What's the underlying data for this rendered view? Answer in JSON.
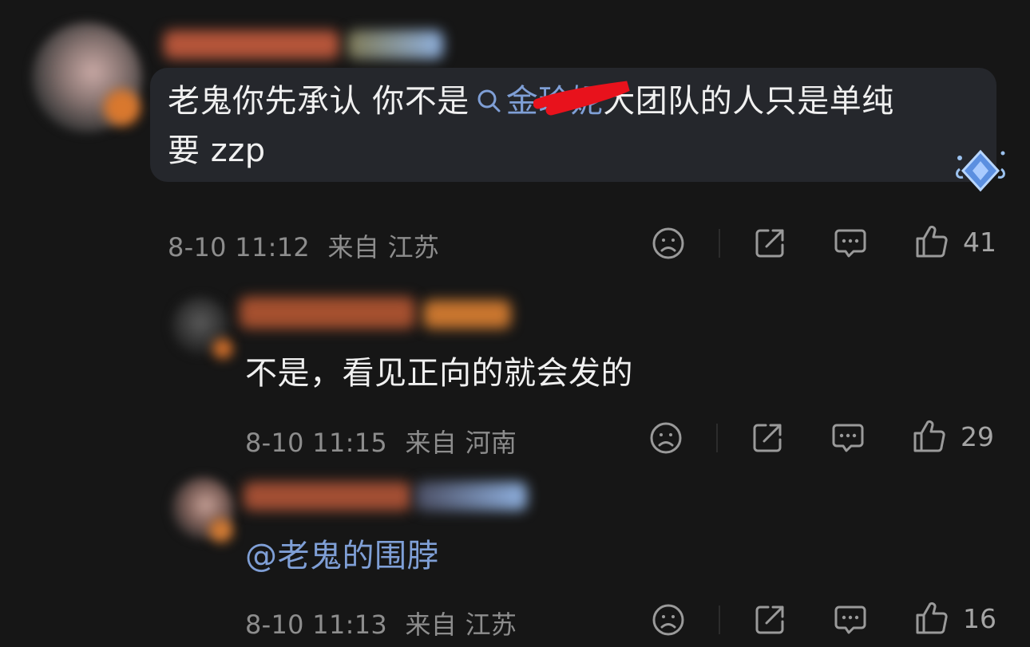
{
  "comments": [
    {
      "text_before": "老鬼你先承认 你不是",
      "link_text": "金珍妮",
      "text_line1_after": "大团队的人只是单纯",
      "text_line2": "要 zzp",
      "time": "8-10 11:12",
      "location": "来自 江苏",
      "likes": "41"
    },
    {
      "text": "不是，看见正向的就会发的",
      "time": "8-10 11:15",
      "location": "来自 河南",
      "likes": "29"
    },
    {
      "mention": "@老鬼的围脖",
      "time": "8-10 11:13",
      "location": "来自 江苏",
      "likes": "16"
    }
  ],
  "icons": [
    "sad-face-icon",
    "share-icon",
    "comment-icon",
    "thumbs-up-icon",
    "search-icon",
    "diamond-badge-icon"
  ],
  "colors": {
    "background": "#161616",
    "bubble": "#25272c",
    "link": "#7f9fd6",
    "meta": "#8d8d8d",
    "redaction": "#e8121c"
  }
}
